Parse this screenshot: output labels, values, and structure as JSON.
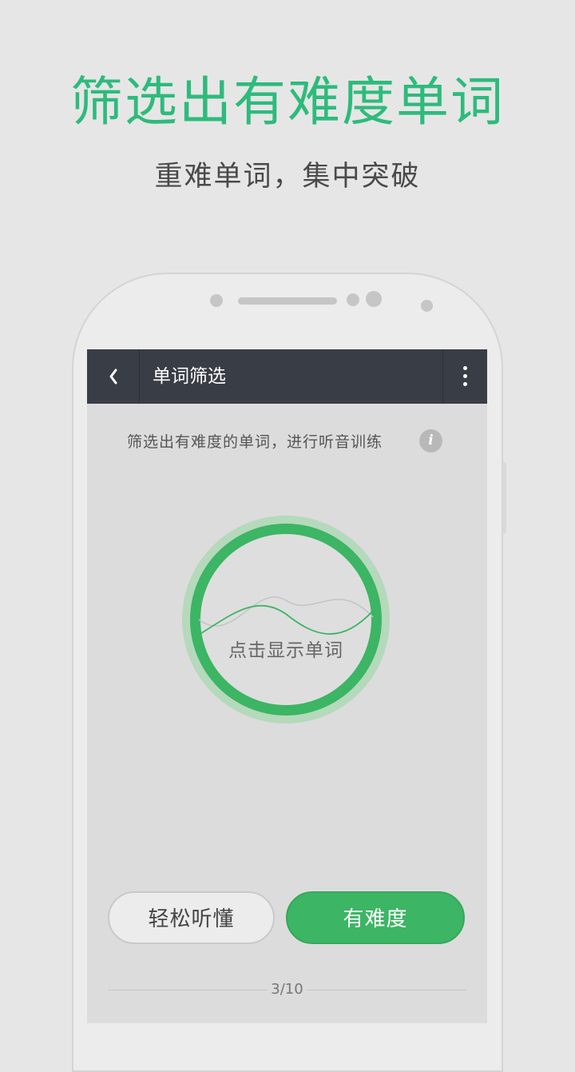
{
  "promo": {
    "title": "筛选出有难度单词",
    "subtitle": "重难单词，集中突破"
  },
  "app_bar": {
    "back_icon": "chevron-left-icon",
    "title": "单词筛选",
    "menu_icon": "more-vertical-icon"
  },
  "main": {
    "hint": "筛选出有难度的单词，进行听音训练",
    "info_icon_text": "i",
    "circle_label": "点击显示单词",
    "buttons": {
      "easy_label": "轻松听懂",
      "hard_label": "有难度"
    },
    "progress": "3/10"
  },
  "colors": {
    "accent_green": "#3cb564",
    "title_green": "#2dbb7c",
    "app_bar": "#393d46",
    "screen_bg": "#dcdcdc"
  }
}
